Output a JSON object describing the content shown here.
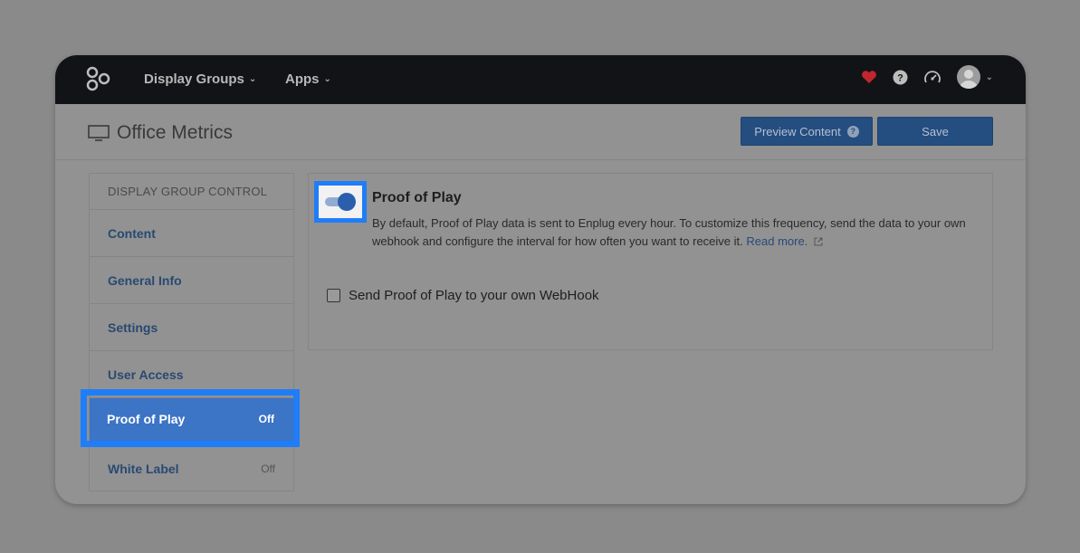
{
  "topbar": {
    "nav": [
      {
        "label": "Display Groups"
      },
      {
        "label": "Apps"
      }
    ],
    "icons": [
      "heart-icon",
      "help-icon",
      "dashboard-icon",
      "avatar"
    ]
  },
  "header": {
    "title": "Office Metrics",
    "preview_label": "Preview Content",
    "preview_badge": "?",
    "save_label": "Save"
  },
  "sidebar": {
    "heading": "DISPLAY GROUP CONTROL",
    "items": [
      {
        "label": "Content",
        "status": ""
      },
      {
        "label": "General Info",
        "status": ""
      },
      {
        "label": "Settings",
        "status": ""
      },
      {
        "label": "User Access",
        "status": ""
      },
      {
        "label": "Proof of Play",
        "status": "Off"
      },
      {
        "label": "White Label",
        "status": "Off"
      }
    ]
  },
  "panel": {
    "title": "Proof of Play",
    "toggle_on": true,
    "description": "By default, Proof of Play data is sent to Enplug every hour. To customize this frequency, send the data to your own webhook and configure the interval for how often you want to receive it.",
    "read_more": "Read more.",
    "checkbox_label": "Send Proof of Play to your own WebHook"
  },
  "colors": {
    "accent": "#1f7df8",
    "primary_button": "#244d80",
    "active_item": "#3c74c6",
    "heart": "#c0262d"
  }
}
